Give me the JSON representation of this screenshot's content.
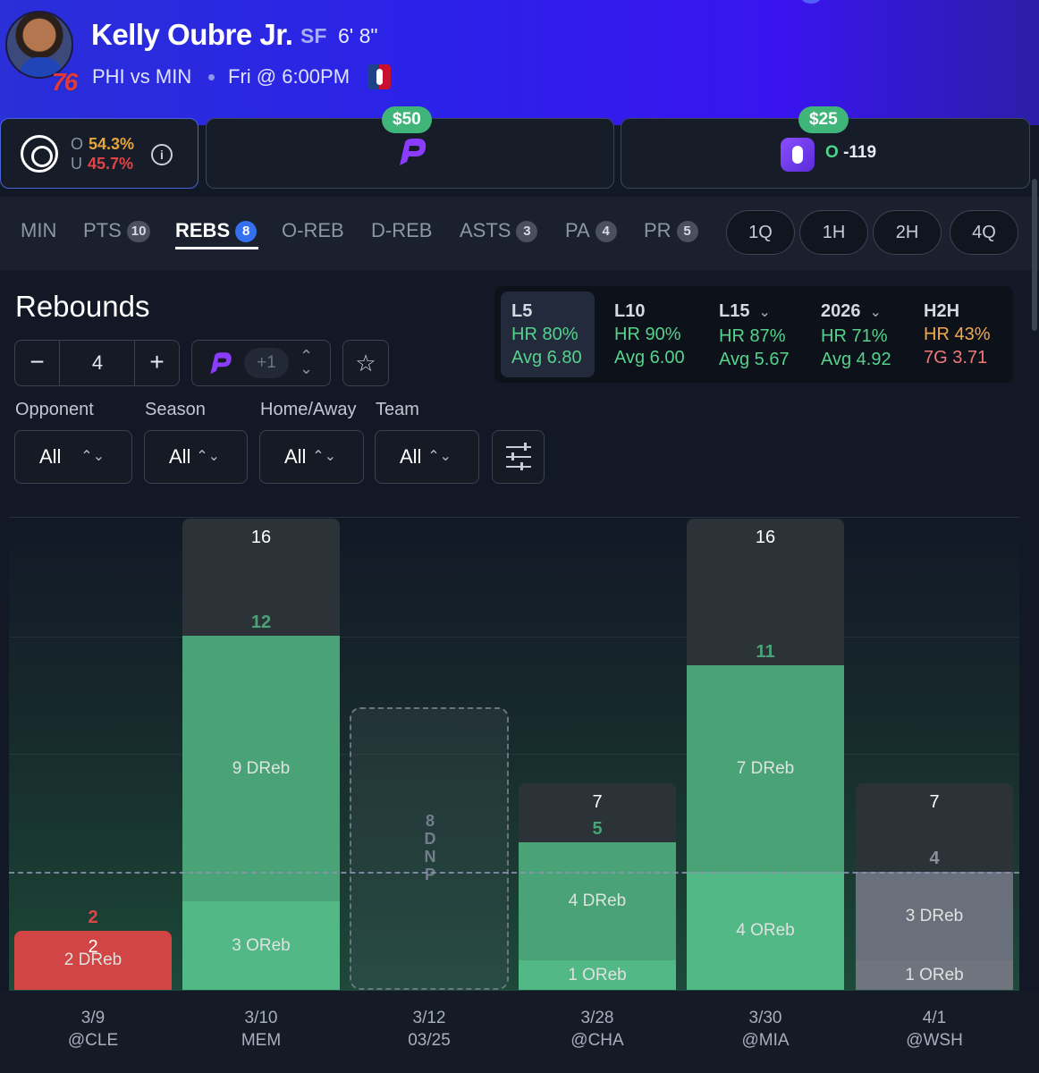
{
  "player": {
    "name": "Kelly Oubre Jr.",
    "position": "SF",
    "height": "6' 8\"",
    "matchup": "PHI vs MIN",
    "game_time": "Fri @ 6:00PM",
    "team_number": "76"
  },
  "odds": {
    "over_label": "O",
    "over_pct": "54.3%",
    "under_label": "U",
    "under_pct": "45.7%",
    "book1_price": "$50",
    "book2_price": "$25",
    "book2_line_prefix": "O",
    "book2_line": "-119"
  },
  "tabs": [
    {
      "label": "MIN",
      "count": ""
    },
    {
      "label": "PTS",
      "count": "10"
    },
    {
      "label": "REBS",
      "count": "8"
    },
    {
      "label": "O-REB",
      "count": ""
    },
    {
      "label": "D-REB",
      "count": ""
    },
    {
      "label": "ASTS",
      "count": "3"
    },
    {
      "label": "PA",
      "count": "4"
    },
    {
      "label": "PR",
      "count": "5"
    }
  ],
  "periods": [
    "1Q",
    "1H",
    "2H",
    "4Q"
  ],
  "section": {
    "title": "Rebounds",
    "line_value": "4",
    "boost_value": "+1"
  },
  "summary": [
    {
      "label": "L5",
      "line1": "HR 80%",
      "line2": "Avg 6.80"
    },
    {
      "label": "L10",
      "line1": "HR 90%",
      "line2": "Avg 6.00"
    },
    {
      "label": "L15",
      "line1": "HR 87%",
      "line2": "Avg 5.67"
    },
    {
      "label": "2026",
      "line1": "HR 71%",
      "line2": "Avg 4.92"
    },
    {
      "label": "H2H",
      "line1": "HR 43%",
      "line2": "7G 3.71"
    }
  ],
  "filters": [
    {
      "label": "Opponent",
      "value": "All"
    },
    {
      "label": "Season",
      "value": "All"
    },
    {
      "label": "Home/Away",
      "value": "All"
    },
    {
      "label": "Team",
      "value": "All"
    }
  ],
  "colors": {
    "hit": "#4fb07f",
    "hit_upper": "#4aa377",
    "miss": "#d14545",
    "push": "#70757f",
    "accent": "#3470f0"
  },
  "chart_data": {
    "type": "bar",
    "line": 4,
    "ylim": [
      0,
      16
    ],
    "games": [
      {
        "date": "3/9",
        "opp": "@CLE",
        "total": "2",
        "result": "2",
        "segments": [
          {
            "label": "2 DReb",
            "value": 2
          }
        ],
        "outcome": "miss"
      },
      {
        "date": "3/10",
        "opp": "MEM",
        "total": "16",
        "result": "12",
        "segments": [
          {
            "label": "3 OReb",
            "value": 3
          },
          {
            "label": "9 DReb",
            "value": 9
          }
        ],
        "outcome": "hit"
      },
      {
        "date": "3/12",
        "opp": "03/25",
        "total": "",
        "result": "",
        "segments": [],
        "outcome": "dnp",
        "dnp_label": "8DNP"
      },
      {
        "date": "3/28",
        "opp": "@CHA",
        "total": "7",
        "result": "5",
        "segments": [
          {
            "label": "1 OReb",
            "value": 1
          },
          {
            "label": "4 DReb",
            "value": 4
          }
        ],
        "outcome": "hit"
      },
      {
        "date": "3/30",
        "opp": "@MIA",
        "total": "16",
        "result": "11",
        "segments": [
          {
            "label": "4 OReb",
            "value": 4
          },
          {
            "label": "7 DReb",
            "value": 7
          }
        ],
        "outcome": "hit"
      },
      {
        "date": "4/1",
        "opp": "@WSH",
        "total": "7",
        "result": "4",
        "segments": [
          {
            "label": "1 OReb",
            "value": 1
          },
          {
            "label": "3 DReb",
            "value": 3
          }
        ],
        "outcome": "push"
      }
    ]
  }
}
